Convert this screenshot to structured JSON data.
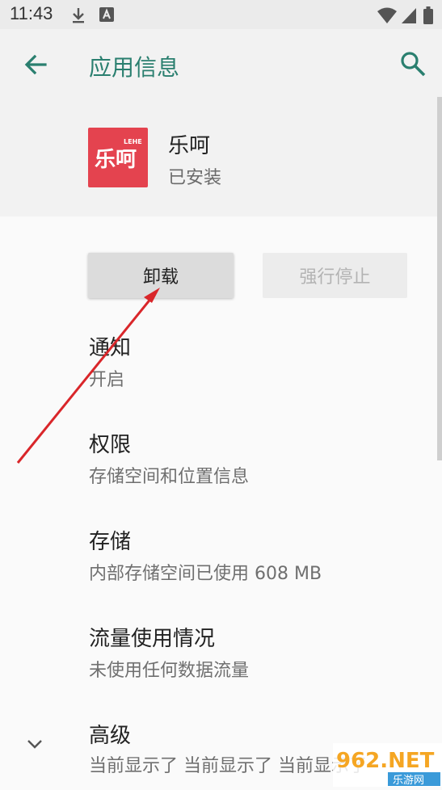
{
  "status_bar": {
    "time": "11:43",
    "icons": [
      "download-icon",
      "notification-a-icon",
      "wifi-icon",
      "cell-signal-icon",
      "battery-icon"
    ]
  },
  "app_bar": {
    "title": "应用信息",
    "back_icon": "arrow-left-icon",
    "search_icon": "search-icon",
    "accent_color": "#2a7f6f"
  },
  "app": {
    "name": "乐呵",
    "status": "已安装",
    "icon_text": "乐呵",
    "icon_badge": "LEHE",
    "icon_color": "#e4434f"
  },
  "buttons": {
    "uninstall": "卸载",
    "force_stop": "强行停止"
  },
  "settings": [
    {
      "title": "通知",
      "subtitle": "开启"
    },
    {
      "title": "权限",
      "subtitle": "存储空间和位置信息"
    },
    {
      "title": "存储",
      "subtitle": "内部存储空间已使用 608 MB"
    },
    {
      "title": "流量使用情况",
      "subtitle": "未使用任何数据流量"
    },
    {
      "title": "高级",
      "subtitle": "当前显示了 当前显示了 当前显示了"
    }
  ],
  "watermark": {
    "brand": "962.NET",
    "subtext": "乐游网"
  }
}
